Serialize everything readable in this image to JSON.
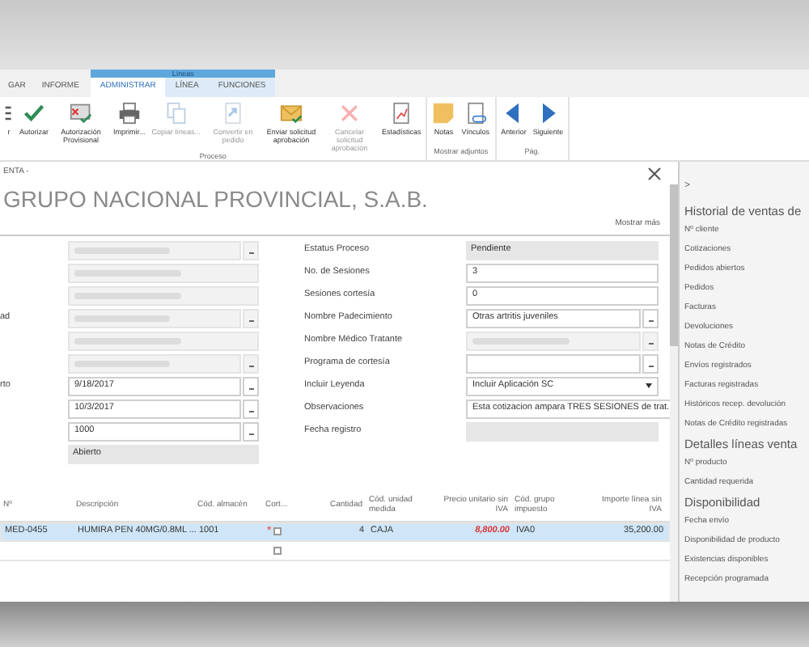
{
  "ribbon": {
    "contextual_group": "Líneas",
    "tabs": [
      {
        "label": "GAR",
        "selected": false,
        "contextual": false
      },
      {
        "label": "INFORME",
        "selected": false,
        "contextual": false
      },
      {
        "label": "ADMINISTRAR",
        "selected": true,
        "contextual": true
      },
      {
        "label": "LÍNEA",
        "selected": false,
        "contextual": true
      },
      {
        "label": "FUNCIONES",
        "selected": false,
        "contextual": true
      }
    ],
    "groups": [
      {
        "label": "Proceso",
        "buttons": [
          {
            "label": "r",
            "kind": "partial",
            "disabled": false
          },
          {
            "label": "Autorizar",
            "kind": "check",
            "disabled": false
          },
          {
            "label": "Autorización Provisional",
            "kind": "provisional",
            "disabled": false
          },
          {
            "label": "Imprimir...",
            "kind": "print",
            "disabled": false
          },
          {
            "label": "Copiar líneas...",
            "kind": "copy",
            "disabled": true
          },
          {
            "label": "Convertir en pedido",
            "kind": "convert",
            "disabled": true
          },
          {
            "label": "Enviar solicitud aprobación",
            "kind": "mail",
            "disabled": false
          },
          {
            "label": "Cancelar solicitud aprobación",
            "kind": "cancel",
            "disabled": true
          },
          {
            "label": "Estadísticas",
            "kind": "stats",
            "disabled": false
          }
        ]
      },
      {
        "label": "Mostrar adjuntos",
        "buttons": [
          {
            "label": "Notas",
            "kind": "note",
            "disabled": false
          },
          {
            "label": "Vínculos",
            "kind": "link",
            "disabled": false
          }
        ]
      },
      {
        "label": "Pág.",
        "buttons": [
          {
            "label": "Anterior",
            "kind": "prev",
            "disabled": false
          },
          {
            "label": "Siguiente",
            "kind": "next",
            "disabled": false
          }
        ]
      }
    ]
  },
  "header": {
    "caption": "ENTA -",
    "title": "GRUPO NACIONAL PROVINCIAL, S.A.B.",
    "show_more": "Mostrar más"
  },
  "left_fields": [
    {
      "kind": "blurred",
      "lookup": true
    },
    {
      "kind": "blurred",
      "lookup": false
    },
    {
      "kind": "blurred",
      "lookup": false
    },
    {
      "label": "ad",
      "kind": "blurred",
      "lookup": true
    },
    {
      "kind": "blurred",
      "lookup": false
    },
    {
      "kind": "blurred",
      "lookup": true
    },
    {
      "label": "rto",
      "kind": "text",
      "value": "9/18/2017",
      "lookup": true
    },
    {
      "kind": "text",
      "value": "10/3/2017",
      "lookup": true
    },
    {
      "kind": "text",
      "value": "1000",
      "lookup": true
    },
    {
      "kind": "readonly",
      "value": "Abierto",
      "lookup": false
    }
  ],
  "right_fields": [
    {
      "label": "Estatus Proceso",
      "kind": "readonly",
      "value": "Pendiente",
      "lookup": false
    },
    {
      "label": "No. de Sesiones",
      "kind": "text",
      "value": "3",
      "lookup": false
    },
    {
      "label": "Sesiones cortesía",
      "kind": "text",
      "value": "0",
      "lookup": false
    },
    {
      "label": "Nombre Padecimiento",
      "kind": "text",
      "value": "Otras artritis juveniles",
      "lookup": true
    },
    {
      "label": "Nombre Médico Tratante",
      "kind": "blurred",
      "lookup": true
    },
    {
      "label": "Programa de cortesía",
      "kind": "text",
      "lookup": true
    },
    {
      "label": "Incluir Leyenda",
      "kind": "dropdown",
      "value": "Incluir Aplicación SC",
      "lookup": false
    },
    {
      "label": "Observaciones",
      "kind": "text",
      "value": "Esta cotizacion ampara TRES SESIONES de trat.",
      "lookup": false
    },
    {
      "label": "Fecha registro",
      "kind": "readonly",
      "lookup": false
    }
  ],
  "lines": {
    "columns": [
      {
        "label": "Nº"
      },
      {
        "label": "Descripción"
      },
      {
        "label": "Cód. almacén"
      },
      {
        "label": "Cort..."
      },
      {
        "label": "Cantidad"
      },
      {
        "label": "Cód. unidad medida"
      },
      {
        "label": "Precio unitario sin IVA"
      },
      {
        "label": "Cód. grupo impuesto"
      },
      {
        "label": "Importe línea sin IVA"
      }
    ],
    "rows": [
      {
        "selected": true,
        "required_mark": "*",
        "checked": false,
        "price_alert": true,
        "cells": [
          "MED-0455",
          "HUMIRA PEN 40MG/0.8ML ...",
          "1001",
          "",
          "4",
          "CAJA",
          "8,800.00",
          "IVA0",
          "35,200.00"
        ]
      },
      {
        "selected": false,
        "checked": false,
        "cells": [
          "",
          "",
          "",
          "",
          "",
          "",
          "",
          "",
          ""
        ]
      }
    ]
  },
  "factbox": {
    "toggle": ">",
    "sections": [
      {
        "title": "Historial de ventas de",
        "items": [
          "Nº cliente",
          "Cotizaciones",
          "Pedidos abiertos",
          "Pedidos",
          "Facturas",
          "Devoluciones",
          "Notas de Crédito",
          "Envíos registrados",
          "Facturas registradas",
          "Históricos recep. devolución",
          "Notas de Crédito registradas"
        ]
      },
      {
        "title": "Detalles líneas venta",
        "items": [
          "Nº producto",
          "Cantidad requerida"
        ]
      },
      {
        "title": "Disponibilidad",
        "items": [
          "Fecha envío",
          "Disponibilidad de producto",
          "Existencias disponibles",
          "Recepción programada"
        ]
      }
    ]
  }
}
